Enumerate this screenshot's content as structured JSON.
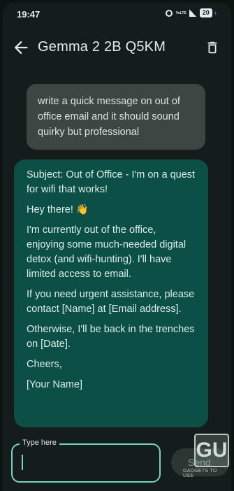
{
  "status_bar": {
    "time": "19:47",
    "volte": "VoLTE",
    "battery": "20"
  },
  "app_bar": {
    "title": "Gemma 2 2B Q5KM",
    "back_icon": "arrow-back-icon",
    "delete_icon": "trash-icon"
  },
  "messages": [
    {
      "role": "user",
      "text": "write a quick message on out of office email and it should sound quirky but professional"
    },
    {
      "role": "assistant",
      "paragraphs": [
        "Subject: Out of Office - I'm on a quest for wifi that works!",
        "Hey there! 👋",
        "I'm currently out of the office, enjoying some much-needed digital detox (and wifi-hunting).  I'll have limited access to email.",
        "If you need urgent assistance, please contact [Name] at [Email address].",
        "Otherwise, I'll be back in the trenches on [Date].",
        "Cheers,",
        "[Your Name]"
      ]
    }
  ],
  "composer": {
    "label": "Type here",
    "value": "",
    "send_label": "Send"
  },
  "watermark": {
    "logo": "GU",
    "text": "GADGETS TO USE"
  },
  "colors": {
    "background": "#141d1b",
    "user_bubble": "#3c4744",
    "assistant_bubble": "#0b4f47",
    "accent": "#79d3c1"
  }
}
